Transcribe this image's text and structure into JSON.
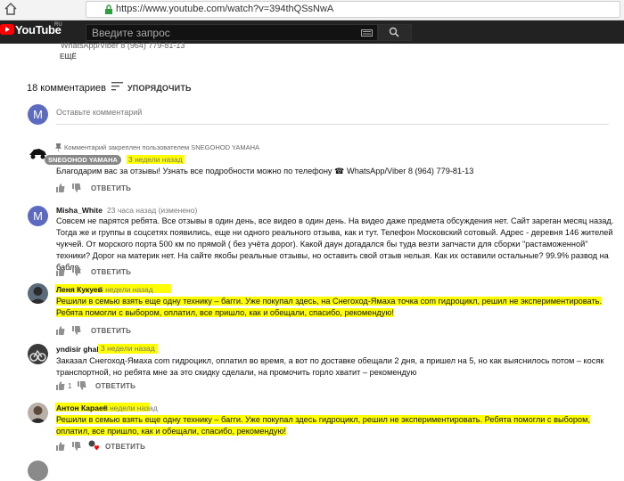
{
  "browser": {
    "url": "https://www.youtube.com/watch?v=394thQSsNwA"
  },
  "youtube": {
    "logo_text": "YouTube",
    "region": "RU",
    "search_placeholder": "Введите запрос"
  },
  "video": {
    "desc_partial": "WhatsApp/Viber 8 (964) 779-81-13",
    "more_label": "ЕЩЁ"
  },
  "comments": {
    "count_label": "18 комментариев",
    "sort_label": "УПОРЯДОЧИТЬ",
    "add_avatar_letter": "M",
    "add_placeholder": "Оставьте комментарий",
    "reply_label": "ОТВЕТИТЬ",
    "items": [
      {
        "pinned_note": "Комментарий закреплен пользователем SNEGOHOD YAMAHA",
        "author": "SNEGOHOD YAMAHA",
        "time": "3 недели назад",
        "text": "Благодарим вас за отзывы! Узнать все подробности можно по телефону ☎ WhatsApp/Viber 8 (964) 779-81-13"
      },
      {
        "avatar_letter": "M",
        "author": "Misha_White",
        "time": "23 часа назад (изменено)",
        "text": "Совсем не парятся ребята. Все отзывы в один день, все видео в один день. На видео даже предмета обсуждения нет. Сайт зареган месяц назад. Тогда же и группы в соцсетях появились, еще ни одного реального отзыва, как и тут. Телефон Московский сотовый. Адрес - деревня 146 жителей чукчей. От морского порта 500 км по прямой ( без учёта дорог). Какой даун догадался бы туда везти запчасти для сборки \"растаможенной\" техники? Дорог на материк нет. На сайте якобы реальные отзывы, но оставить свой отзыв нельзя. Как их оставили остальные? 99.9% развод на бабло."
      },
      {
        "author": "Леня Кукуев",
        "time": "3 недели назад",
        "text": "Решили в семью взять еще одну технику – багги. Уже покупал здесь, на Снегоход-Ямаха точка com гидроцикл, решил не экспериментировать. Ребята помогли с выбором, оплатил, все пришло, как и обещали, спасибо, рекомендую!"
      },
      {
        "author": "yndisir ghalfir",
        "time": "3 недели назад",
        "text": "Заказал Снегоход-Ямаха com гидроцикл, оплатил во время, а вот по доставке обещали 2 дня, а пришел на 5, но как выяснилось потом – косяк транспортной, но ребята мне за это скидку сделали, на промочить горло хватит – рекомендую",
        "likes": "1"
      },
      {
        "author": "Антон Караев",
        "time": "3 недели назад",
        "text": "Решили в семью взять еще одну технику – багги. Уже покупал здесь гидроцикл, решил не экспериментировать. Ребята помогли с выбором, оплатил, все пришло, как и обещали, спасибо, рекомендую!"
      }
    ]
  },
  "colors": {
    "highlight": "#ffff00",
    "yt_dark": "#222222",
    "yt_red": "#ff0000",
    "avatar_blue": "#5c6bc0"
  }
}
